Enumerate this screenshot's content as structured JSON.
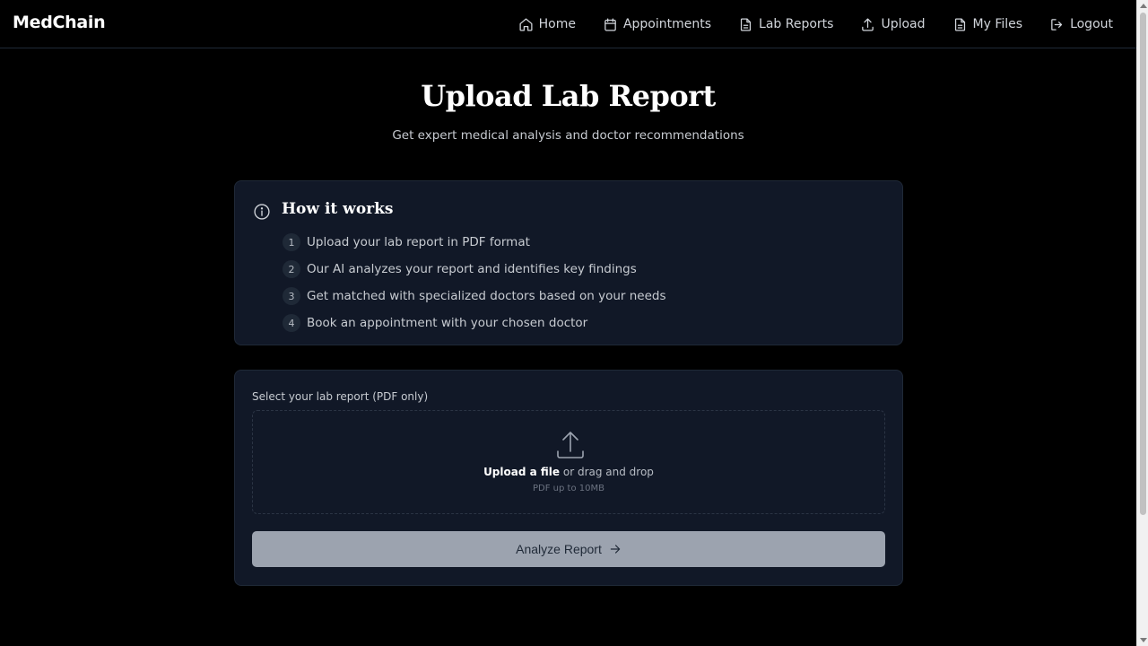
{
  "app": {
    "brand": "MedChain"
  },
  "nav": {
    "items": [
      {
        "label": "Home",
        "icon": "home-icon"
      },
      {
        "label": "Appointments",
        "icon": "calendar-icon"
      },
      {
        "label": "Lab Reports",
        "icon": "document-icon"
      },
      {
        "label": "Upload",
        "icon": "upload-icon"
      },
      {
        "label": "My Files",
        "icon": "document-icon"
      },
      {
        "label": "Logout",
        "icon": "logout-icon"
      }
    ]
  },
  "header": {
    "title": "Upload Lab Report",
    "subtitle": "Get expert medical analysis and doctor recommendations"
  },
  "how_it_works": {
    "title": "How it works",
    "icon": "info-icon",
    "steps": [
      {
        "num": "1",
        "text": "Upload your lab report in PDF format"
      },
      {
        "num": "2",
        "text": "Our AI analyzes your report and identifies key findings"
      },
      {
        "num": "3",
        "text": "Get matched with specialized doctors based on your needs"
      },
      {
        "num": "4",
        "text": "Book an appointment with your chosen doctor"
      }
    ]
  },
  "upload": {
    "label": "Select your lab report (PDF only)",
    "link_text": "Upload a file",
    "drag_text": " or drag and drop",
    "hint": "PDF up to 10MB",
    "button_label": "Analyze Report"
  },
  "colors": {
    "background": "#000000",
    "card": "#111827",
    "button": "#9ca3af"
  }
}
